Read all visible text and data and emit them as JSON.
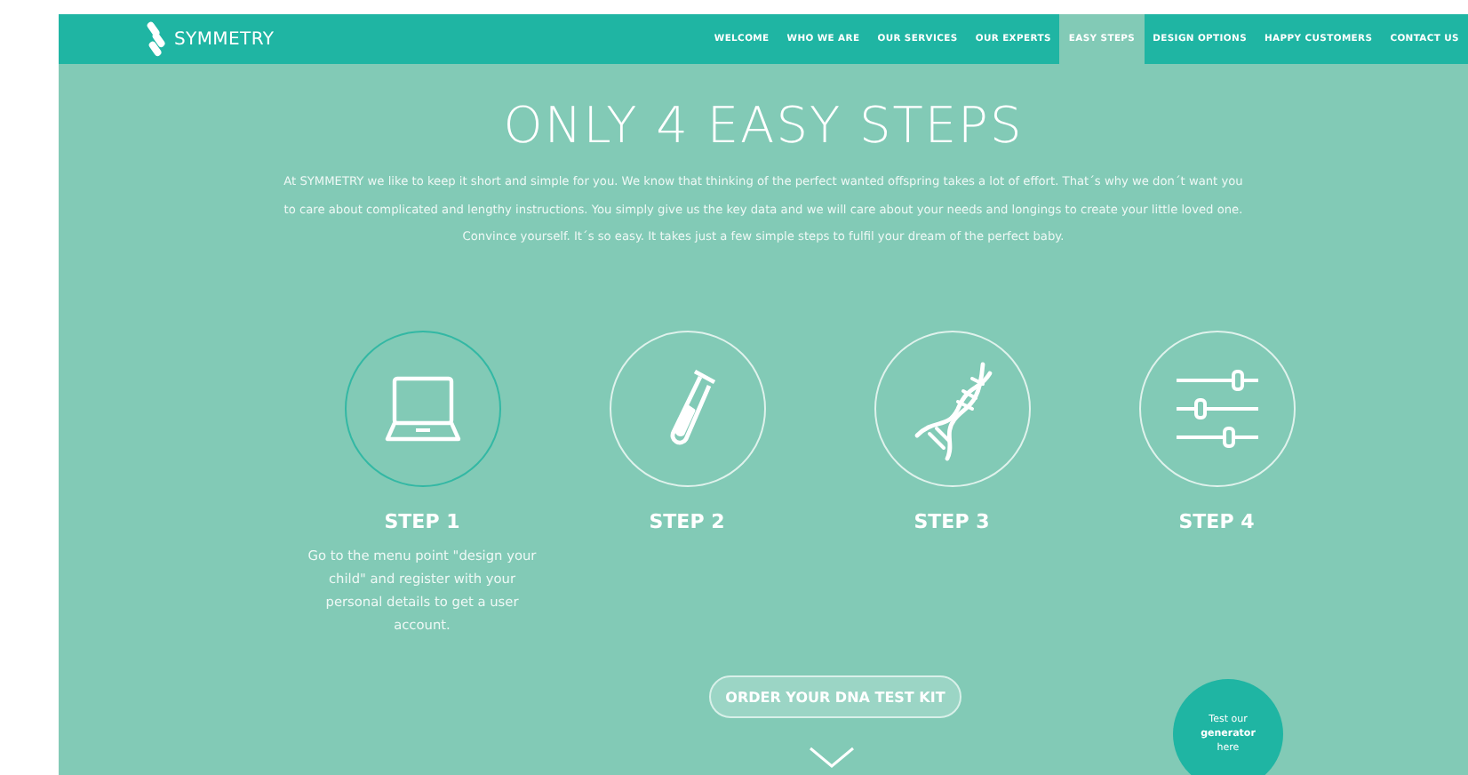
{
  "brand": {
    "name": "SYMMETRY"
  },
  "nav": [
    {
      "label": "WELCOME",
      "selected": false
    },
    {
      "label": "WHO WE ARE",
      "selected": false
    },
    {
      "label": "OUR SERVICES",
      "selected": false
    },
    {
      "label": "OUR EXPERTS",
      "selected": false
    },
    {
      "label": "EASY STEPS",
      "selected": true
    },
    {
      "label": "DESIGN OPTIONS",
      "selected": false
    },
    {
      "label": "HAPPY CUSTOMERS",
      "selected": false
    },
    {
      "label": "CONTACT US",
      "selected": false
    }
  ],
  "heading": "ONLY 4 EASY STEPS",
  "intro": "At SYMMETRY we like to keep it short and simple for you. We know that thinking of the perfect wanted offspring takes a lot of effort. That´s why we don´t want you to care about complicated and lengthy instructions. You simply give us the key data and we will care about your needs and longings to create your little loved one. Convince yourself. It´s so easy. It takes just a few simple steps to fulfil your dream of the perfect baby.",
  "steps": [
    {
      "kind": "laptop",
      "label": "STEP 1",
      "selected": true,
      "description": "Go to the menu point \"design your child\" and register with your personal details to get a user account."
    },
    {
      "kind": "tube",
      "label": "STEP 2",
      "selected": false
    },
    {
      "kind": "dna",
      "label": "STEP 3",
      "selected": false
    },
    {
      "kind": "sliders",
      "label": "STEP 4",
      "selected": false
    }
  ],
  "order_button": "ORDER YOUR DNA TEST KIT",
  "generator_badge": "Test our **generator** here"
}
